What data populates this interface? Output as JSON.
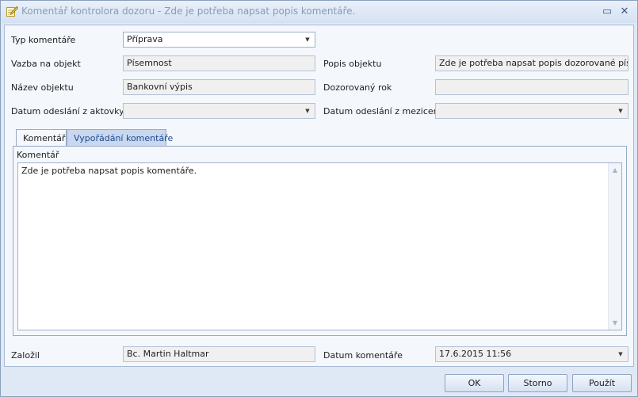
{
  "window": {
    "title": "Komentář kontrolora dozoru - Zde je potřeba napsat popis komentáře.",
    "minimize_glyph": "▭",
    "close_glyph": "✕"
  },
  "form": {
    "typ_komentare": {
      "label": "Typ komentáře",
      "value": "Příprava"
    },
    "vazba_na_objekt": {
      "label": "Vazba na objekt",
      "value": "Písemnost"
    },
    "popis_objektu": {
      "label": "Popis objektu",
      "value": "Zde je potřeba napsat popis dozorované písemnosti"
    },
    "nazev_objektu": {
      "label": "Název objektu",
      "value": "Bankovní výpis"
    },
    "dozorovany_rok": {
      "label": "Dozorovaný rok",
      "value": ""
    },
    "datum_odeslani_aktovky": {
      "label": "Datum odeslání z aktovky",
      "value": ""
    },
    "datum_odeslani_mezicentra": {
      "label": "Datum odeslání z mezicentra",
      "value": ""
    },
    "zalozil": {
      "label": "Založil",
      "value": "Bc. Martin Haltmar"
    },
    "datum_komentare": {
      "label": "Datum komentáře",
      "value": "17.6.2015 11:56"
    }
  },
  "tabs": [
    {
      "label": "Komentář",
      "active": true
    },
    {
      "label": "Vypořádání komentáře",
      "active": false
    }
  ],
  "comment_panel": {
    "label": "Komentář",
    "text": "Zde je potřeba napsat popis komentáře."
  },
  "buttons": {
    "ok": "OK",
    "storno": "Storno",
    "pouzit": "Použít"
  },
  "icons": {
    "title_icon": "note-pencil-icon",
    "combo_arrow": "chevron-down-icon"
  }
}
